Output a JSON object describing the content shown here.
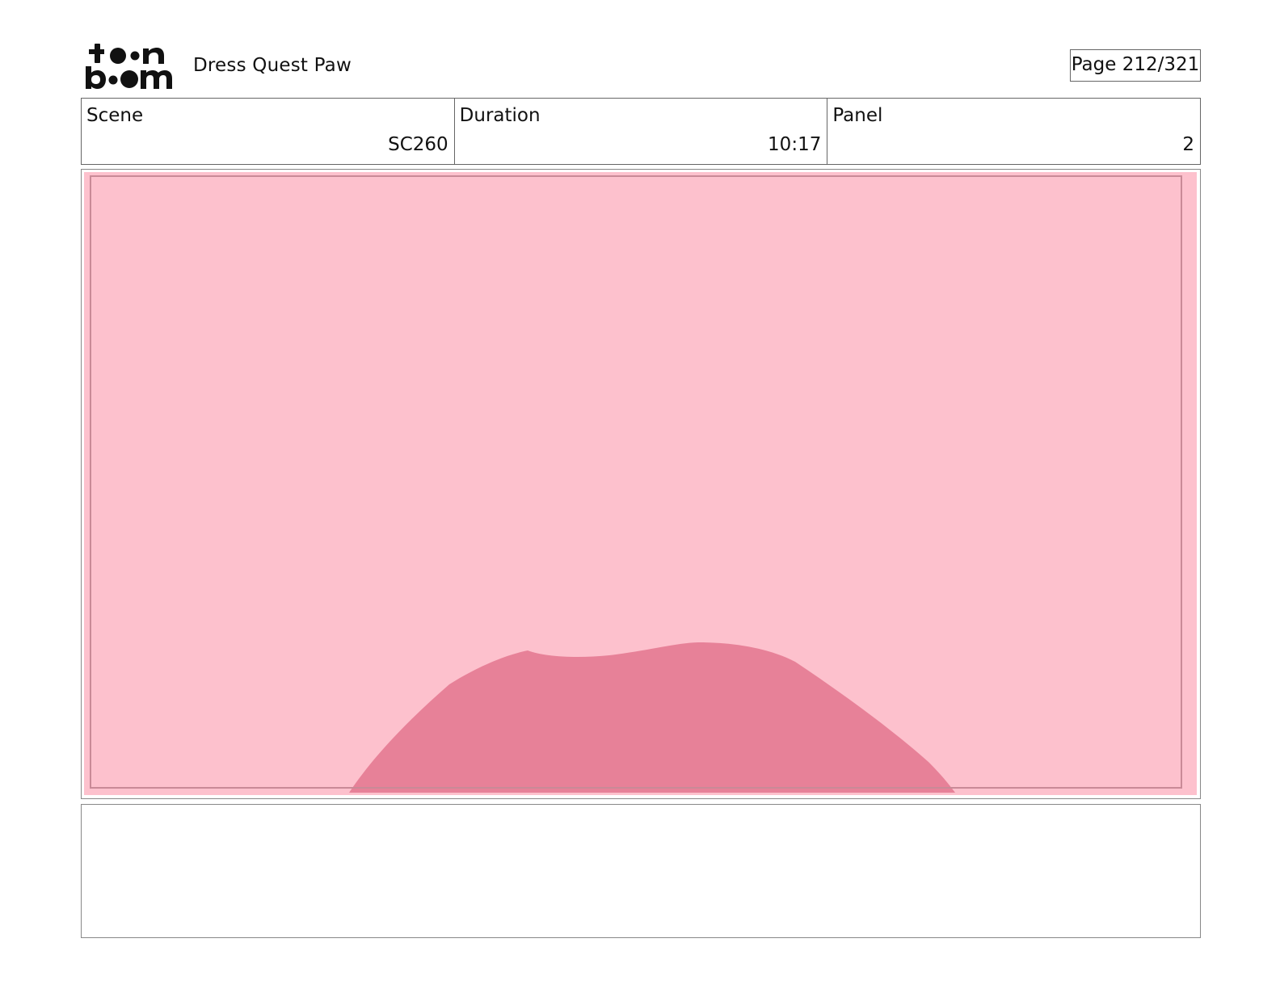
{
  "header": {
    "logo_text_top": "toon",
    "logo_text_bottom": "boom",
    "project_title": "Dress Quest Paw",
    "page_label": "Page 212/321"
  },
  "info": {
    "scene_label": "Scene",
    "scene_value": "SC260",
    "duration_label": "Duration",
    "duration_value": "10:17",
    "panel_label": "Panel",
    "panel_value": "2"
  },
  "panel": {
    "background_color": "#fdc1cd",
    "shape_color": "#e78198",
    "border_color": "#c98a97"
  },
  "notes": {
    "text": ""
  }
}
